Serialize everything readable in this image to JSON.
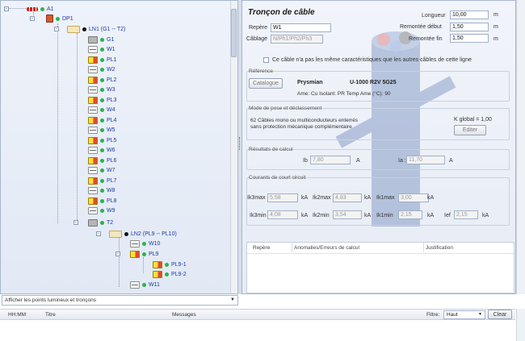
{
  "tree": {
    "nodes": [
      {
        "label": "A1"
      },
      {
        "label": "DP1"
      },
      {
        "label": "LN1 (G1 -- T2)"
      },
      {
        "label": "G1"
      },
      {
        "label": "W1"
      },
      {
        "label": "PL1"
      },
      {
        "label": "W2"
      },
      {
        "label": "PL2"
      },
      {
        "label": "W3"
      },
      {
        "label": "PL3"
      },
      {
        "label": "W4"
      },
      {
        "label": "PL4"
      },
      {
        "label": "W5"
      },
      {
        "label": "PL5"
      },
      {
        "label": "W6"
      },
      {
        "label": "PL6"
      },
      {
        "label": "W7"
      },
      {
        "label": "PL7"
      },
      {
        "label": "W8"
      },
      {
        "label": "PL8"
      },
      {
        "label": "W9"
      },
      {
        "label": "T2"
      },
      {
        "label": "LN2 (PL9 -- PL10)"
      },
      {
        "label": "W10"
      },
      {
        "label": "PL9"
      },
      {
        "label": "PL9-1"
      },
      {
        "label": "PL9-2"
      },
      {
        "label": "W11"
      }
    ]
  },
  "filter_combo": {
    "value": "Afficher les points lumineux et tronçons"
  },
  "panel": {
    "title": "Tronçon de câble",
    "repere_label": "Repère",
    "repere_value": "W1",
    "cablage_label": "Câblage",
    "cablage_value": "N/Ph1/Ph2/Ph3",
    "longueur_label": "Longueur",
    "longueur_value": "10,00",
    "longueur_unit": "m",
    "remontee_debut_label": "Remontée début",
    "remontee_debut_value": "1,50",
    "remontee_debut_unit": "m",
    "remontee_fin_label": "Remontée fin",
    "remontee_fin_value": "1,50",
    "remontee_fin_unit": "m",
    "checkbox_label": "Ce câble n'a pas les même caractéristiques que les autres câbles de cette ligne",
    "reference": {
      "title": "Référence",
      "catalogue_button": "Catalogue",
      "brand": "Prysmian",
      "model": "U-1000 R2V 5G25",
      "details": "Ame: Cu  Isolant: PR  Temp Ame (°C): 90"
    },
    "mode_pose": {
      "title": "Mode de pose et déclassement",
      "description_line1": "62 Câbles mono ou multiconducteurs enterrés",
      "description_line2": "sans protection mécanique complémentaire",
      "k_global": "K global = 1,00",
      "edit_button": "Editer"
    },
    "resultats": {
      "title": "Résultats de calcul",
      "ib_label": "Ib",
      "ib_value": "7,80",
      "ib_unit": "A",
      "ia_label": "Ia :",
      "ia_value": "11,70",
      "ia_unit": "A"
    },
    "courants": {
      "title": "Courants de court circuit",
      "row1": [
        {
          "label": "Ik3max",
          "value": "5,58",
          "unit": "kA"
        },
        {
          "label": "Ik2max",
          "value": "4,83",
          "unit": "kA"
        },
        {
          "label": "Ik1max",
          "value": "3,00",
          "unit": "kA"
        }
      ],
      "row2": [
        {
          "label": "Ik3min",
          "value": "4,08",
          "unit": "kA"
        },
        {
          "label": "Ik2min",
          "value": "3,54",
          "unit": "kA"
        },
        {
          "label": "Ik1min",
          "value": "2,15",
          "unit": "kA"
        },
        {
          "label": "Ief",
          "value": "2,15",
          "unit": "kA"
        }
      ]
    },
    "table": {
      "col_repere": "Repère",
      "col_anomalies": "Anomalies/Erreurs de calcul",
      "col_justification": "Justification"
    }
  },
  "log": {
    "col_time": "HH:MM",
    "col_title": "Titre",
    "col_messages": "Messages",
    "filter_label": "Filtre:",
    "filter_value": "Haut",
    "clear_button": "Clear"
  },
  "colors": {
    "tree_text": "#1c3aa0",
    "status_green": "#2ab34a",
    "panel_bg": "#e7ecf5"
  }
}
